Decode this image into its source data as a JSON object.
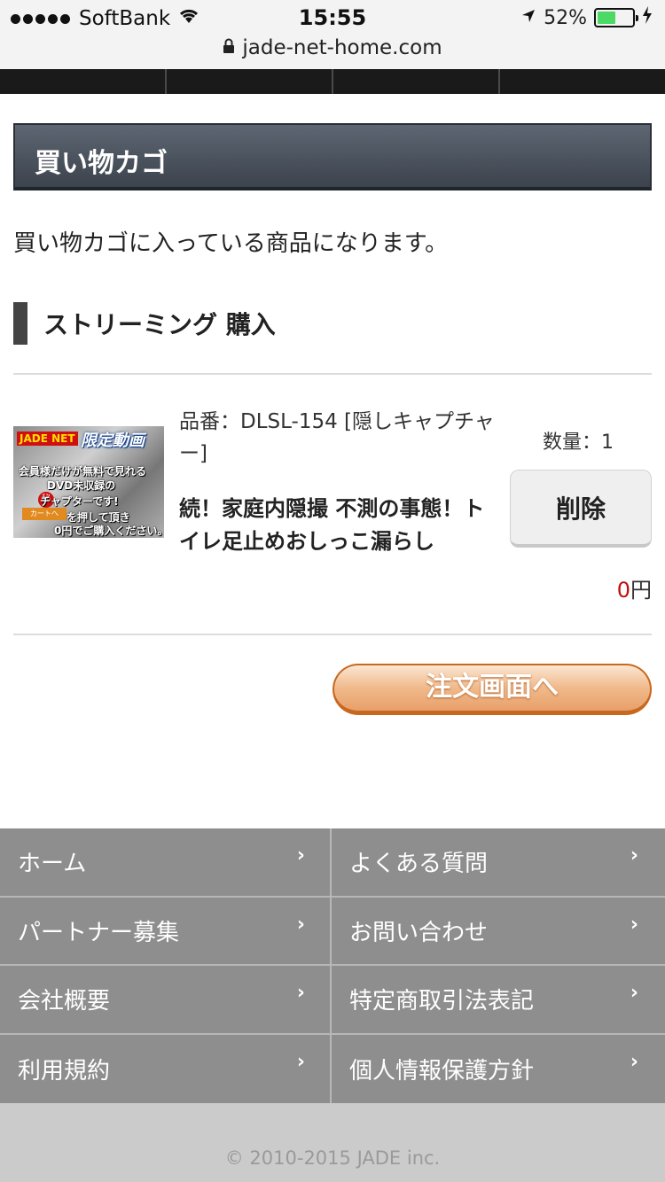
{
  "status_bar": {
    "carrier": "SoftBank",
    "time": "15:55",
    "battery": "52%",
    "battery_level": 0.52
  },
  "url_bar": {
    "url": "jade-net-home.com"
  },
  "page": {
    "title": "買い物カゴ",
    "intro": "買い物カゴに入っている商品になります。",
    "section_title": "ストリーミング 購入"
  },
  "cart_item": {
    "thumbnail": {
      "logo": "JADE NET",
      "headline": "限定動画",
      "line1": "会員様だけが無料で見れる",
      "line2": "DVD未収録の",
      "stamp": "秘",
      "line3": "チャプターです!",
      "button": "カートへ",
      "line4": "を押して頂き",
      "line5": "0円でご購入ください。"
    },
    "code_line": "品番：DLSL-154 [隠しキャプチャー]",
    "name": "続！家庭内隠撮 不測の事態！トイレ足止めおしっこ漏らし",
    "quantity_label": "数量：1",
    "delete_label": "削除",
    "price_num": "0",
    "price_unit": "円"
  },
  "order_button": {
    "label": "注文画面へ"
  },
  "footer_nav": [
    {
      "label": "ホーム"
    },
    {
      "label": "よくある質問"
    },
    {
      "label": "パートナー募集"
    },
    {
      "label": "お問い合わせ"
    },
    {
      "label": "会社概要"
    },
    {
      "label": "特定商取引法表記"
    },
    {
      "label": "利用規約"
    },
    {
      "label": "個人情報保護方針"
    }
  ],
  "footer_chevron": "›",
  "copyright": "© 2010-2015 JADE inc."
}
